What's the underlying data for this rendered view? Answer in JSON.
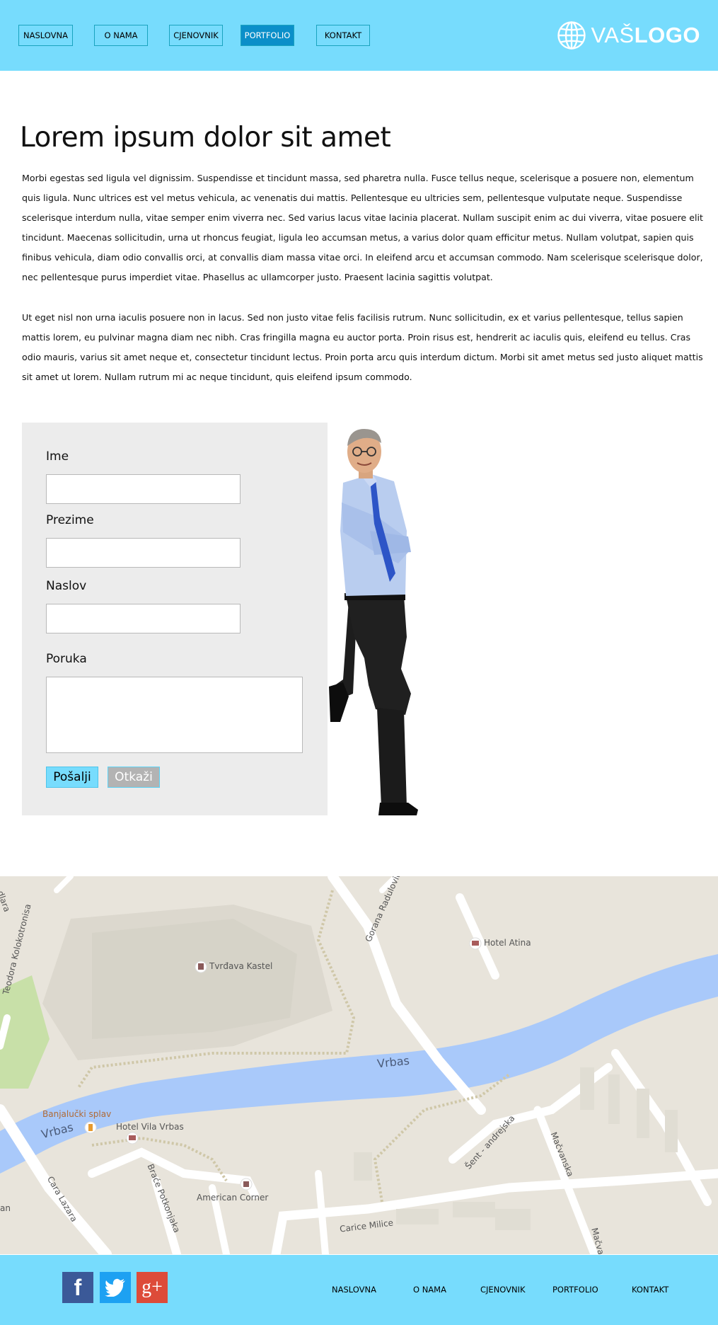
{
  "nav": {
    "items": [
      {
        "label": "NASLOVNA"
      },
      {
        "label": "O NAMA"
      },
      {
        "label": "CJENOVNIK"
      },
      {
        "label": "PORTFOLIO"
      },
      {
        "label": "KONTAKT"
      }
    ],
    "active": "PORTFOLIO"
  },
  "logo": {
    "prefix": "VAŠ",
    "main": "LOGO"
  },
  "main": {
    "title": "Lorem ipsum dolor sit amet",
    "paragraph1": "Morbi egestas sed ligula vel dignissim. Suspendisse et tincidunt massa, sed pharetra nulla. Fusce tellus neque, scelerisque a posuere non, elementum quis ligula. Nunc ultrices est vel metus vehicula, ac venenatis dui mattis. Pellentesque eu ultricies sem, pellentesque vulputate neque. Suspendisse scelerisque interdum nulla, vitae semper enim viverra nec. Sed varius lacus vitae lacinia placerat. Nullam suscipit enim ac dui viverra, vitae posuere elit tincidunt. Maecenas sollicitudin, urna ut rhoncus feugiat, ligula leo accumsan metus, a varius dolor quam efficitur metus. Nullam volutpat, sapien quis finibus vehicula, diam odio convallis orci, at convallis diam massa vitae orci. In eleifend arcu et accumsan commodo. Nam scelerisque scelerisque dolor, nec pellentesque purus imperdiet vitae. Phasellus ac ullamcorper justo. Praesent lacinia sagittis volutpat.",
    "paragraph2": "Ut eget nisl non urna iaculis posuere non in lacus. Sed non justo vitae felis facilisis rutrum. Nunc sollicitudin, ex et varius pellentesque, tellus sapien mattis lorem, eu pulvinar magna diam nec nibh. Cras fringilla magna eu auctor porta. Proin risus est, hendrerit ac iaculis quis, eleifend eu tellus. Cras odio mauris, varius sit amet neque et, consectetur tincidunt lectus. Proin porta arcu quis interdum dictum. Morbi sit amet metus sed justo aliquet mattis sit amet ut lorem. Nullam rutrum mi ac neque tincidunt, quis eleifend ipsum commodo."
  },
  "form": {
    "first_name_label": "Ime",
    "first_name_value": "",
    "last_name_label": "Prezime",
    "last_name_value": "",
    "subject_label": "Naslov",
    "subject_value": "",
    "message_label": "Poruka",
    "message_value": "",
    "submit_label": "Pošalji",
    "cancel_label": "Otkaži"
  },
  "map": {
    "labels": {
      "hotel_atina": "Hotel Atina",
      "tvrdava": "Tvrđava Kastel",
      "gorana": "Gorana Radulovića Bimb",
      "teodora": "Teodora Kolokotronisa",
      "vrbas_main": "Vrbas",
      "vrbas_left": "Vrbas",
      "splav": "Banjalučki splav",
      "hotel_vila": "Hotel Vila Vrbas",
      "brace": "Braće Potkonjaka",
      "american": "American Corner",
      "cara_lazara": "Cara Lazara",
      "carice": "Carice Milice",
      "sent": "Šent - andrejska",
      "macvanska": "Mačvanska",
      "macvan2": "Mačvan",
      "dlara": "dlara",
      "an": "an"
    },
    "colors": {
      "land": "#e8e4db",
      "river": "#a9c9fa",
      "road": "#ffffff",
      "park": "#c8e0a8"
    }
  },
  "footer": {
    "social": [
      {
        "icon": "facebook-icon",
        "letter": "f",
        "color": "#3b5998"
      },
      {
        "icon": "twitter-icon",
        "letter": "t",
        "color": "#1da1f2"
      },
      {
        "icon": "google-plus-icon",
        "letter": "g+",
        "color": "#dd4b39"
      }
    ],
    "nav": [
      {
        "label": "NASLOVNA"
      },
      {
        "label": "O NAMA"
      },
      {
        "label": "CJENOVNIK"
      },
      {
        "label": "PORTFOLIO"
      },
      {
        "label": "KONTAKT"
      }
    ]
  },
  "colors": {
    "header_bg": "#77dcfd",
    "active_nav": "#0b8fc9",
    "form_bg": "#ececec"
  }
}
